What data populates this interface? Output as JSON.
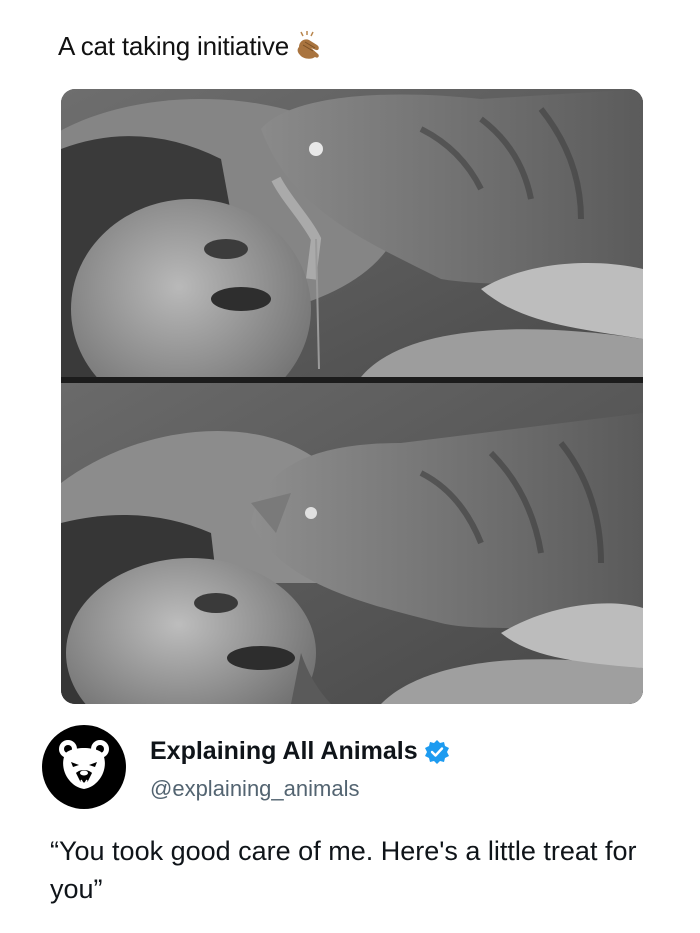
{
  "post": {
    "caption": "A cat taking initiative",
    "caption_emoji": "clapping-hands-icon"
  },
  "media": {
    "panels": 2
  },
  "profile": {
    "display_name": "Explaining All Animals",
    "handle": "@explaining_animals",
    "verified": true,
    "verified_color": "#1d9bf0",
    "avatar_icon": "bear-icon"
  },
  "quote": {
    "text": "“You took good care of me. Here's a little treat for you”"
  }
}
